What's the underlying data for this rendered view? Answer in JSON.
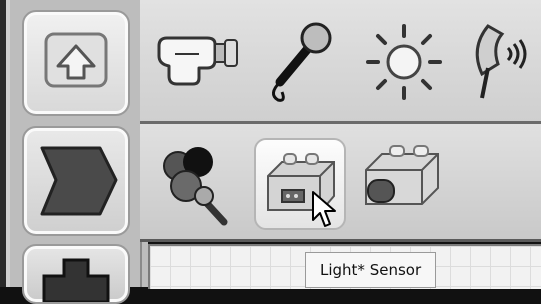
{
  "palette": {
    "categories": [
      {
        "icon": "up-arrow-icon"
      },
      {
        "icon": "chevron-block-icon"
      },
      {
        "icon": "puzzle-block-icon"
      }
    ],
    "sensor_row_1": [
      {
        "icon": "touch-sensor-icon"
      },
      {
        "icon": "microphone-icon"
      },
      {
        "icon": "sun-icon"
      },
      {
        "icon": "ultrasonic-sensor-icon"
      }
    ],
    "sensor_row_2": [
      {
        "icon": "color-sensor-icon"
      },
      {
        "icon": "light-sensor-icon",
        "selected": true
      },
      {
        "icon": "compare-sensor-icon"
      }
    ]
  },
  "tooltip": {
    "text": "Light* Sensor"
  },
  "colors": {
    "panel": "#d6d6d6",
    "selected_bg": "#f5f5f5",
    "canvas": "#f2f2f2"
  }
}
